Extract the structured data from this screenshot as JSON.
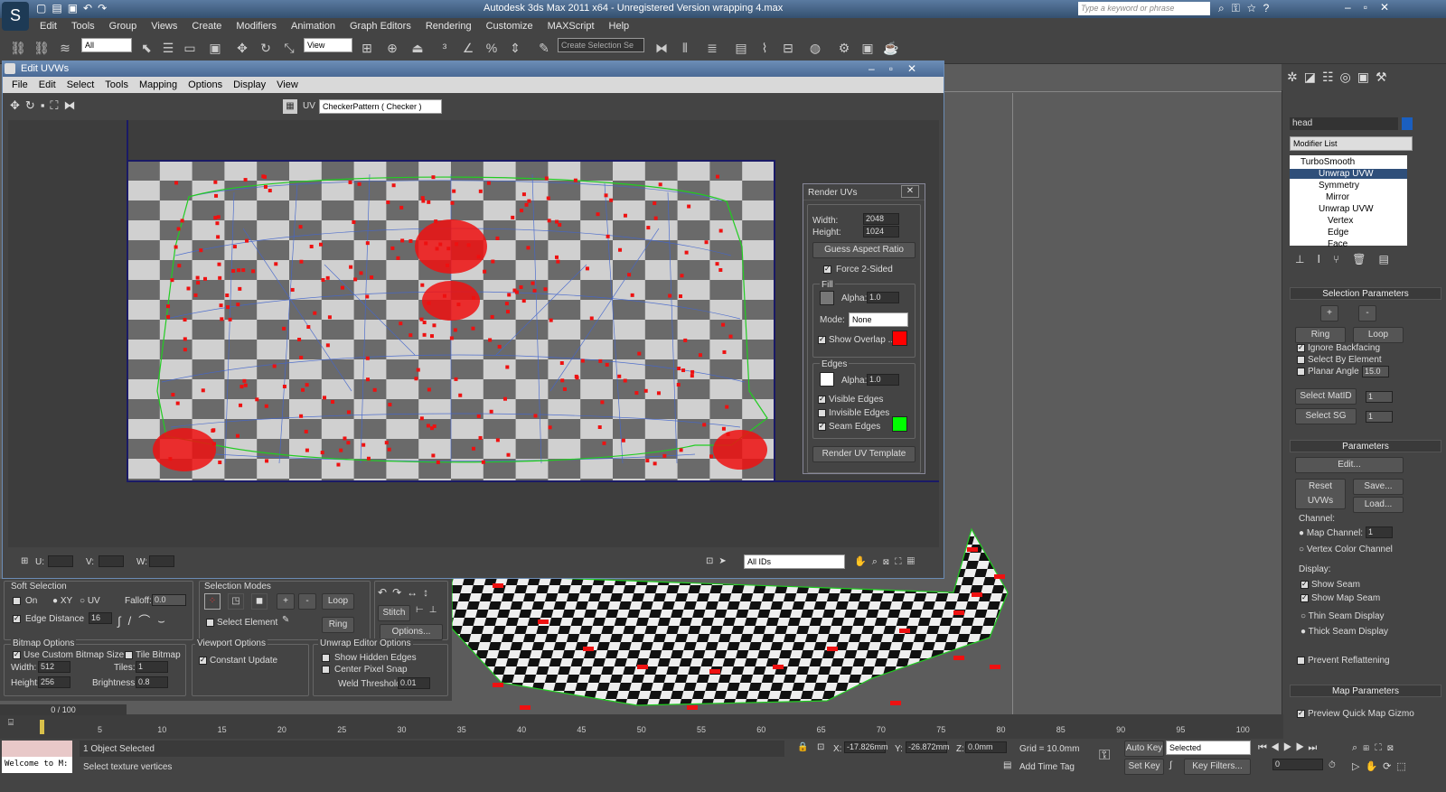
{
  "app": {
    "title": "Autodesk 3ds Max  2011 x64   - Unregistered Version    wrapping 4.max",
    "search_placeholder": "Type a keyword or phrase"
  },
  "menu": [
    "Edit",
    "Tools",
    "Group",
    "Views",
    "Create",
    "Modifiers",
    "Animation",
    "Graph Editors",
    "Rendering",
    "Customize",
    "MAXScript",
    "Help"
  ],
  "toolbar": {
    "filter": "All",
    "view": "View",
    "named_sel": "Create Selection Se"
  },
  "uv": {
    "title": "Edit UVWs",
    "menu": [
      "File",
      "Edit",
      "Select",
      "Tools",
      "Mapping",
      "Options",
      "Display",
      "View"
    ],
    "map_label": "UV",
    "checker": "CheckerPattern  ( Checker )",
    "u": "U:",
    "v": "V:",
    "w": "W:",
    "ids": "All IDs"
  },
  "render": {
    "title": "Render UVs",
    "width_label": "Width:",
    "width": "2048",
    "height_label": "Height:",
    "height": "1024",
    "guess": "Guess Aspect Ratio",
    "force": "Force 2-Sided",
    "fill": "Fill",
    "alpha_label": "Alpha:",
    "fill_alpha": "1.0",
    "mode_label": "Mode:",
    "mode": "None",
    "overlap": "Show Overlap ...",
    "edges": "Edges",
    "edges_alpha": "1.0",
    "visible": "Visible Edges",
    "invisible": "Invisible Edges",
    "seam": "Seam Edges",
    "button": "Render UV Template",
    "overlap_color": "#ff0000",
    "seam_color": "#00ff00"
  },
  "bottom": {
    "soft": "Soft Selection",
    "on": "On",
    "xy": "XY",
    "uvl": "UV",
    "falloff": "Falloff:",
    "falloff_val": "0.0",
    "edge_dist": "Edge Distance",
    "edge_val": "16",
    "modes": "Selection Modes",
    "loop": "Loop",
    "ring": "Ring",
    "select_element": "Select Element",
    "stitch": "Stitch",
    "options": "Options...",
    "bitmap": "Bitmap Options",
    "custom": "Use Custom Bitmap Size",
    "tile": "Tile Bitmap",
    "bw_label": "Width:",
    "bw": "512",
    "bh_label": "Height:",
    "bh": "256",
    "tiles": "Tiles:",
    "tiles_val": "1",
    "bright": "Brightness:",
    "bright_val": "0.8",
    "vp": "Viewport Options",
    "const": "Constant Update",
    "ue": "Unwrap Editor Options",
    "hidden": "Show Hidden Edges",
    "center": "Center Pixel Snap",
    "weld": "Weld Threshold:",
    "weld_val": "0.01"
  },
  "cmd": {
    "name": "head",
    "modlist": "Modifier List",
    "stack": [
      "TurboSmooth",
      "Unwrap UVW",
      "Symmetry",
      "Mirror",
      "Unwrap UVW",
      "Vertex",
      "Edge",
      "Face"
    ],
    "selparams": "Selection Parameters",
    "plus": "+",
    "minus": "-",
    "ring": "Ring",
    "loop": "Loop",
    "ignore": "Ignore Backfacing",
    "bysel": "Select By Element",
    "planar": "Planar Angle",
    "planar_val": "15.0",
    "matid": "Select MatID",
    "sg": "Select SG",
    "one": "1",
    "params": "Parameters",
    "edit": "Edit...",
    "reset": "Reset UVWs",
    "save": "Save...",
    "load": "Load...",
    "channel": "Channel:",
    "mapch": "Map Channel:",
    "mapch_val": "1",
    "vcc": "Vertex Color Channel",
    "display": "Display:",
    "showseam": "Show Seam",
    "showmap": "Show Map Seam",
    "thin": "Thin Seam Display",
    "thick": "Thick Seam Display",
    "prevent": "Prevent Reflattening",
    "mapparams": "Map Parameters",
    "preview": "Preview Quick Map Gizmo"
  },
  "timeline": {
    "frame": "0 / 100",
    "ticks": [
      "5",
      "10",
      "15",
      "20",
      "25",
      "30",
      "35",
      "40",
      "45",
      "50",
      "55",
      "60",
      "65",
      "70",
      "75",
      "80",
      "85",
      "90",
      "95",
      "100"
    ]
  },
  "status": {
    "welcome": "Welcome to M:",
    "objsel": "1 Object Selected",
    "prompt": "Select texture vertices",
    "x_label": "X:",
    "x": "-17.826mm",
    "y_label": "Y:",
    "y": "-26.872mm",
    "z_label": "Z:",
    "z": "0.0mm",
    "grid": "Grid = 10.0mm",
    "timetag": "Add Time Tag",
    "autokey": "Auto Key",
    "selected": "Selected",
    "setkey": "Set Key",
    "keyfilters": "Key Filters...",
    "frame": "0"
  }
}
